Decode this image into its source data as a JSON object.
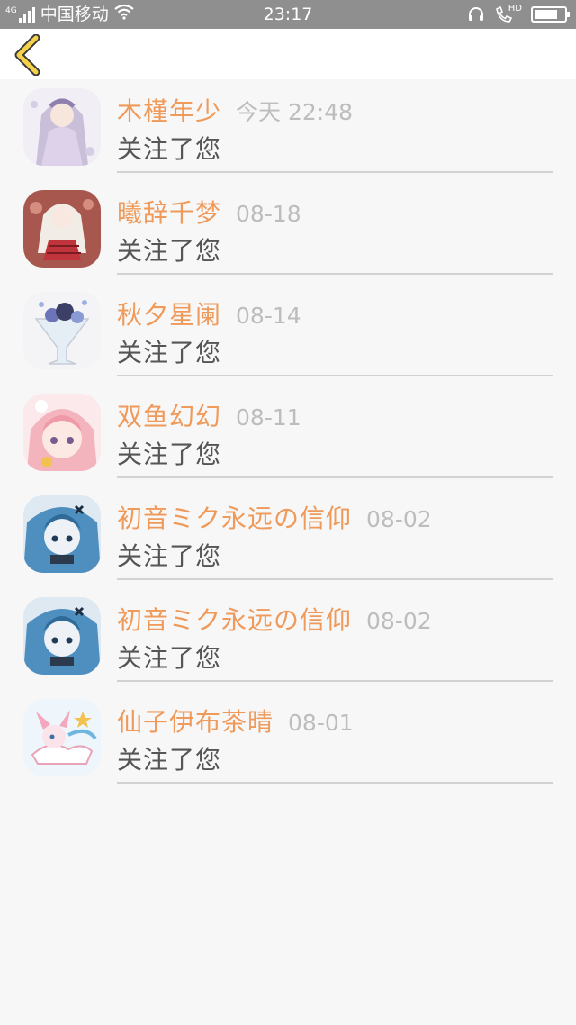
{
  "status_bar": {
    "network": "4G",
    "carrier": "中国移动",
    "time": "23:17",
    "call_badge": "HD"
  },
  "nav": {
    "back_icon": "chevron-left-icon",
    "accent": "#f5d24a"
  },
  "colors": {
    "name": "#ef9a5a",
    "time": "#bdbdbd",
    "message": "#555555"
  },
  "notifications": [
    {
      "name": "木槿年少",
      "time": "今天 22:48",
      "message": "关注了您",
      "avatar": "avatar-lavender-girl"
    },
    {
      "name": "曦辞千梦",
      "time": "08-18",
      "message": "关注了您",
      "avatar": "avatar-red-dress-girl"
    },
    {
      "name": "秋夕星阑",
      "time": "08-14",
      "message": "关注了您",
      "avatar": "avatar-cocktail-glass"
    },
    {
      "name": "双鱼幻幻",
      "time": "08-11",
      "message": "关注了您",
      "avatar": "avatar-pink-hair-girl"
    },
    {
      "name": "初音ミク永远の信仰",
      "time": "08-02",
      "message": "关注了您",
      "avatar": "avatar-blue-hair-girl"
    },
    {
      "name": "初音ミク永远の信仰",
      "time": "08-02",
      "message": "关注了您",
      "avatar": "avatar-blue-hair-girl"
    },
    {
      "name": "仙子伊布茶晴",
      "time": "08-01",
      "message": "关注了您",
      "avatar": "avatar-sylveon"
    }
  ]
}
